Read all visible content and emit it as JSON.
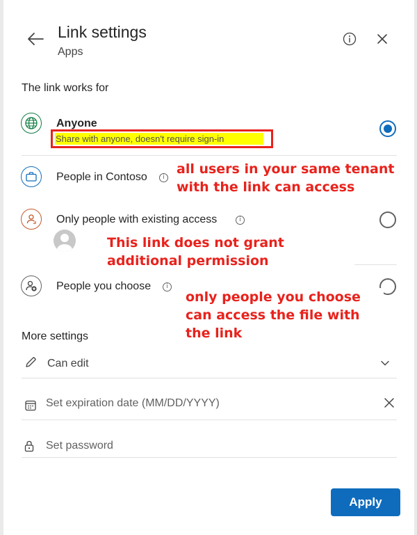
{
  "header": {
    "title": "Link settings",
    "subtitle": "Apps",
    "back_icon": "arrow-left-icon",
    "info_icon": "info-icon",
    "close_icon": "close-icon"
  },
  "link_works_for": {
    "heading": "The link works for",
    "options": [
      {
        "label": "Anyone",
        "description": "Share with anyone, doesn't require sign-in",
        "icon": "globe-icon",
        "selected": true
      },
      {
        "label": "People in Contoso",
        "icon": "briefcase-icon",
        "selected": false
      },
      {
        "label": "Only people with existing access",
        "icon": "person-sync-icon",
        "selected": false
      },
      {
        "label": "People you choose",
        "icon": "person-add-icon",
        "selected": false
      }
    ]
  },
  "annotations": {
    "contoso": "all users in your same tenant with the link can access",
    "existing": "This link does not grant additional permission",
    "choose": "only people you choose can access the file with the link"
  },
  "more_settings": {
    "heading": "More settings",
    "permission": "Can edit",
    "expiration_placeholder": "Set expiration date (MM/DD/YYYY)",
    "password_placeholder": "Set password"
  },
  "footer": {
    "apply_label": "Apply"
  },
  "colors": {
    "accent": "#0f6cbd",
    "annotation_red": "#e8221c",
    "highlight_yellow": "#ffff00",
    "globe_green": "#107c41",
    "briefcase_blue": "#0f6cbd",
    "person_orange": "#c4582a"
  }
}
